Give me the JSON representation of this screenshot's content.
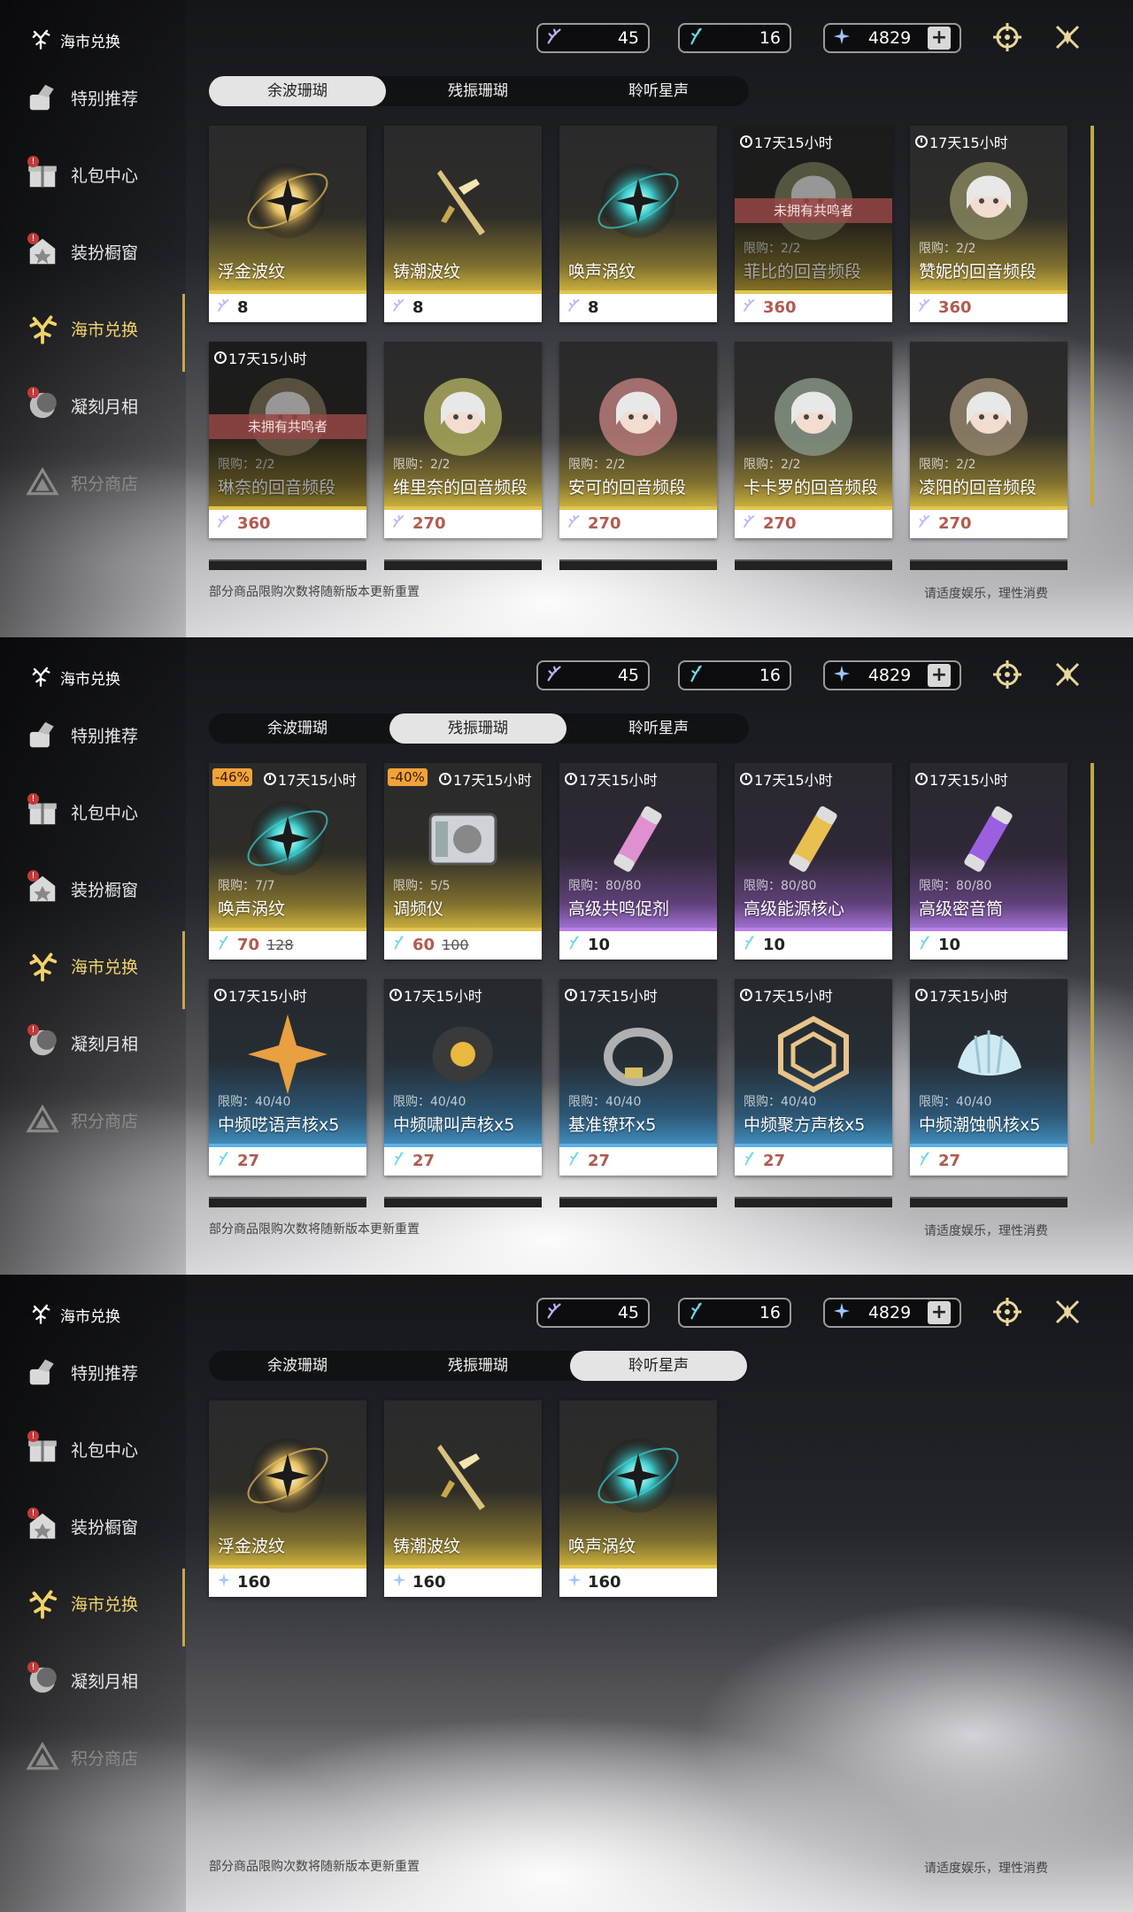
{
  "panels": [
    {
      "brand": "海市兑换",
      "nav": [
        {
          "label": "特别推荐",
          "badge": ""
        },
        {
          "label": "礼包中心",
          "badge": "!"
        },
        {
          "label": "装扮橱窗",
          "badge": "!"
        },
        {
          "label": "海市兑换",
          "badge": ""
        },
        {
          "label": "凝刻月相",
          "badge": "!"
        },
        {
          "label": "积分商店",
          "badge": ""
        }
      ],
      "currency": [
        "45",
        "16",
        "4829"
      ],
      "tabs": [
        "余波珊瑚",
        "残振珊瑚",
        "聆听星声"
      ],
      "active_tab": 0,
      "cards": [
        {
          "name": "浮金波纹",
          "price": "8",
          "timer": "",
          "limit": "",
          "owned": ""
        },
        {
          "name": "铸潮波纹",
          "price": "8",
          "timer": "",
          "limit": "",
          "owned": ""
        },
        {
          "name": "唤声涡纹",
          "price": "8",
          "timer": "",
          "limit": "",
          "owned": ""
        },
        {
          "name": "菲比的回音频段",
          "price": "360",
          "timer": "17天15小时",
          "limit": "限购：2/2",
          "owned": "未拥有共鸣者"
        },
        {
          "name": "赞妮的回音频段",
          "price": "360",
          "timer": "17天15小时",
          "limit": "限购：2/2",
          "owned": ""
        },
        {
          "name": "琳奈的回音频段",
          "price": "360",
          "timer": "17天15小时",
          "limit": "限购：2/2",
          "owned": "未拥有共鸣者"
        },
        {
          "name": "维里奈的回音频段",
          "price": "270",
          "timer": "",
          "limit": "限购：2/2",
          "owned": ""
        },
        {
          "name": "安可的回音频段",
          "price": "270",
          "timer": "",
          "limit": "限购：2/2",
          "owned": ""
        },
        {
          "name": "卡卡罗的回音频段",
          "price": "270",
          "timer": "",
          "limit": "限购：2/2",
          "owned": ""
        },
        {
          "name": "凌阳的回音频段",
          "price": "270",
          "timer": "",
          "limit": "限购：2/2",
          "owned": ""
        }
      ],
      "note": "部分商品限购次数将随新版本更新重置",
      "note2": "请适度娱乐，理性消费"
    },
    {
      "brand": "海市兑换",
      "nav": [
        {
          "label": "特别推荐",
          "badge": ""
        },
        {
          "label": "礼包中心",
          "badge": "!"
        },
        {
          "label": "装扮橱窗",
          "badge": "!"
        },
        {
          "label": "海市兑换",
          "badge": ""
        },
        {
          "label": "凝刻月相",
          "badge": "!"
        },
        {
          "label": "积分商店",
          "badge": ""
        }
      ],
      "currency": [
        "45",
        "16",
        "4829"
      ],
      "tabs": [
        "余波珊瑚",
        "残振珊瑚",
        "聆听星声"
      ],
      "active_tab": 1,
      "cards": [
        {
          "name": "唤声涡纹",
          "price": "70",
          "old": "128",
          "discount": "-46%",
          "timer": "17天15小时",
          "limit": "限购：7/7"
        },
        {
          "name": "调频仪",
          "price": "60",
          "old": "100",
          "discount": "-40%",
          "timer": "17天15小时",
          "limit": "限购：5/5"
        },
        {
          "name": "高级共鸣促剂",
          "price": "10",
          "timer": "17天15小时",
          "limit": "限购：80/80"
        },
        {
          "name": "高级能源核心",
          "price": "10",
          "timer": "17天15小时",
          "limit": "限购：80/80"
        },
        {
          "name": "高级密音筒",
          "price": "10",
          "timer": "17天15小时",
          "limit": "限购：80/80"
        },
        {
          "name": "中频呓语声核x5",
          "price": "27",
          "timer": "17天15小时",
          "limit": "限购：40/40"
        },
        {
          "name": "中频啸叫声核x5",
          "price": "27",
          "timer": "17天15小时",
          "limit": "限购：40/40"
        },
        {
          "name": "基准镣环x5",
          "price": "27",
          "timer": "17天15小时",
          "limit": "限购：40/40"
        },
        {
          "name": "中频聚方声核x5",
          "price": "27",
          "timer": "17天15小时",
          "limit": "限购：40/40"
        },
        {
          "name": "中频潮蚀帆核x5",
          "price": "27",
          "timer": "17天15小时",
          "limit": "限购：40/40"
        }
      ],
      "note": "部分商品限购次数将随新版本更新重置",
      "note2": "请适度娱乐，理性消费"
    },
    {
      "brand": "海市兑换",
      "nav": [
        {
          "label": "特别推荐",
          "badge": ""
        },
        {
          "label": "礼包中心",
          "badge": "!"
        },
        {
          "label": "装扮橱窗",
          "badge": "!"
        },
        {
          "label": "海市兑换",
          "badge": ""
        },
        {
          "label": "凝刻月相",
          "badge": "!"
        },
        {
          "label": "积分商店",
          "badge": ""
        }
      ],
      "currency": [
        "45",
        "16",
        "4829"
      ],
      "tabs": [
        "余波珊瑚",
        "残振珊瑚",
        "聆听星声"
      ],
      "active_tab": 2,
      "cards": [
        {
          "name": "浮金波纹",
          "price": "160"
        },
        {
          "name": "铸潮波纹",
          "price": "160"
        },
        {
          "name": "唤声涡纹",
          "price": "160"
        }
      ],
      "note": "部分商品限购次数将随新版本更新重置",
      "note2": "请适度娱乐，理性消费"
    }
  ],
  "colors": {
    "gold": "#e2c44b",
    "purple": "#b880e8",
    "blue": "#5fb0e4",
    "discount": "#f1a33a",
    "active_nav": "#f1d36a",
    "price_red": "#b25a4f"
  }
}
